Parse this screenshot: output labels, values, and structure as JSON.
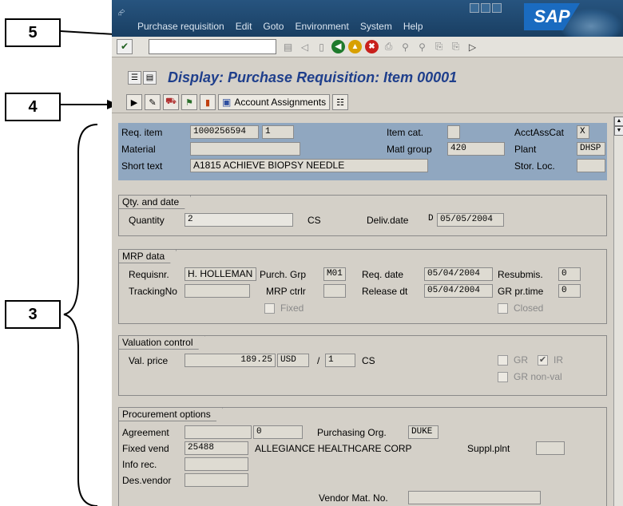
{
  "callouts": {
    "c5": "5",
    "c4": "4",
    "c3": "3"
  },
  "menu": {
    "items": [
      "Purchase requisition",
      "Edit",
      "Goto",
      "Environment",
      "System",
      "Help"
    ],
    "logo": "SAP"
  },
  "title": "Display: Purchase Requisition: Item 00001",
  "toolbar": {
    "account_assignments": "Account Assignments"
  },
  "header": {
    "req_item_label": "Req. item",
    "req_item_value": "1000256594",
    "req_item_no": "1",
    "material_label": "Material",
    "material_value": "",
    "short_text_label": "Short text",
    "short_text_value": "A1815 ACHIEVE BIOPSY NEEDLE",
    "item_cat_label": "Item cat.",
    "item_cat_value": "",
    "matl_group_label": "Matl group",
    "matl_group_value": "420",
    "acctasscat_label": "AcctAssCat",
    "acctasscat_value": "X",
    "plant_label": "Plant",
    "plant_value": "DHSP",
    "stor_loc_label": "Stor. Loc.",
    "stor_loc_value": ""
  },
  "qty": {
    "group_title": "Qty. and date",
    "quantity_label": "Quantity",
    "quantity_value": "2",
    "unit": "CS",
    "deliv_label": "Deliv.date",
    "deliv_type": "D",
    "deliv_value": "05/05/2004"
  },
  "mrp": {
    "group_title": "MRP data",
    "requisnr_label": "Requisnr.",
    "requisnr_value": "H. HOLLEMAN",
    "purch_grp_label": "Purch. Grp",
    "purch_grp_value": "M01",
    "req_date_label": "Req. date",
    "req_date_value": "05/04/2004",
    "resubmis_label": "Resubmis.",
    "resubmis_value": "0",
    "tracking_label": "TrackingNo",
    "tracking_value": "",
    "mrp_ctrlr_label": "MRP ctrlr",
    "mrp_ctrlr_value": "",
    "release_label": "Release dt",
    "release_value": "05/04/2004",
    "gr_pr_label": "GR pr.time",
    "gr_pr_value": "0",
    "fixed_label": "Fixed",
    "closed_label": "Closed"
  },
  "valuation": {
    "group_title": "Valuation control",
    "val_price_label": "Val. price",
    "val_price_value": "189.25",
    "currency": "USD",
    "per": "/",
    "per_value": "1",
    "unit": "CS",
    "gr_label": "GR",
    "ir_label": "IR",
    "gr_nonval_label": "GR non-val"
  },
  "procurement": {
    "group_title": "Procurement options",
    "agreement_label": "Agreement",
    "agreement_value": "",
    "agreement_item": "0",
    "porg_label": "Purchasing Org.",
    "porg_value": "DUKE",
    "fixed_vend_label": "Fixed vend",
    "fixed_vend_value": "25488",
    "fixed_vend_name": "ALLEGIANCE HEALTHCARE CORP",
    "suppl_plnt_label": "Suppl.plnt",
    "suppl_plnt_value": "",
    "info_rec_label": "Info rec.",
    "info_rec_value": "",
    "des_vendor_label": "Des.vendor",
    "des_vendor_value": "",
    "vendor_mat_label": "Vendor Mat. No.",
    "vendor_mat_value": ""
  }
}
